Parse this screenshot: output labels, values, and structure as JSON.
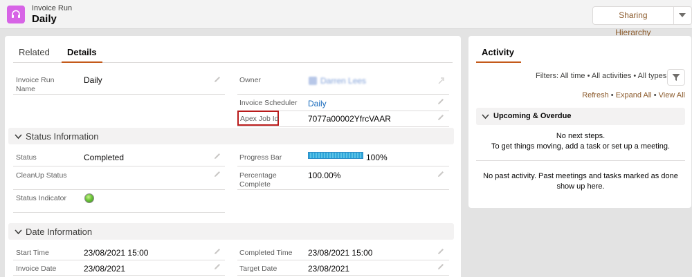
{
  "header": {
    "object_type": "Invoice Run",
    "record_name": "Daily",
    "sharing_button": "Sharing Hierarchy",
    "icon": "headset-icon",
    "icon_color": "#d764e6"
  },
  "tabs": [
    {
      "label": "Related",
      "active": false
    },
    {
      "label": "Details",
      "active": true
    }
  ],
  "details": {
    "invoice_run_name_label": "Invoice Run Name",
    "invoice_run_name_value": "Daily",
    "owner_label": "Owner",
    "owner_value": "Darren Lees",
    "invoice_scheduler_label": "Invoice Scheduler",
    "invoice_scheduler_value": "Daily",
    "apex_job_id_label": "Apex Job Id",
    "apex_job_id_value": "7077a00002YfrcVAAR"
  },
  "status_section": {
    "title": "Status Information",
    "status_label": "Status",
    "status_value": "Completed",
    "cleanup_status_label": "CleanUp Status",
    "status_indicator_label": "Status Indicator",
    "status_indicator_color": "#6cc43a",
    "progress_bar_label": "Progress Bar",
    "progress_bar_text": "100%",
    "progress_fraction": 1.0,
    "percentage_complete_label": "Percentage Complete",
    "percentage_complete_value": "100.00%"
  },
  "date_section": {
    "title": "Date Information",
    "start_time_label": "Start Time",
    "start_time_value": "23/08/2021 15:00",
    "completed_time_label": "Completed Time",
    "completed_time_value": "23/08/2021 15:00",
    "invoice_date_label": "Invoice Date",
    "invoice_date_value": "23/08/2021",
    "target_date_label": "Target Date",
    "target_date_value": "23/08/2021"
  },
  "activity": {
    "tab_label": "Activity",
    "filters_text": "Filters: All time • All activities • All types",
    "refresh": "Refresh",
    "expand_all": "Expand All",
    "view_all": "View All",
    "separator": "•",
    "upcoming_title": "Upcoming & Overdue",
    "no_next_steps": "No next steps.",
    "get_moving": "To get things moving, add a task or set up a meeting.",
    "no_past_activity": "No past activity. Past meetings and tasks marked as done show up here."
  },
  "colors": {
    "accent": "#c45a1a",
    "link": "#1a6cbd",
    "highlight": "#b81a1a"
  }
}
